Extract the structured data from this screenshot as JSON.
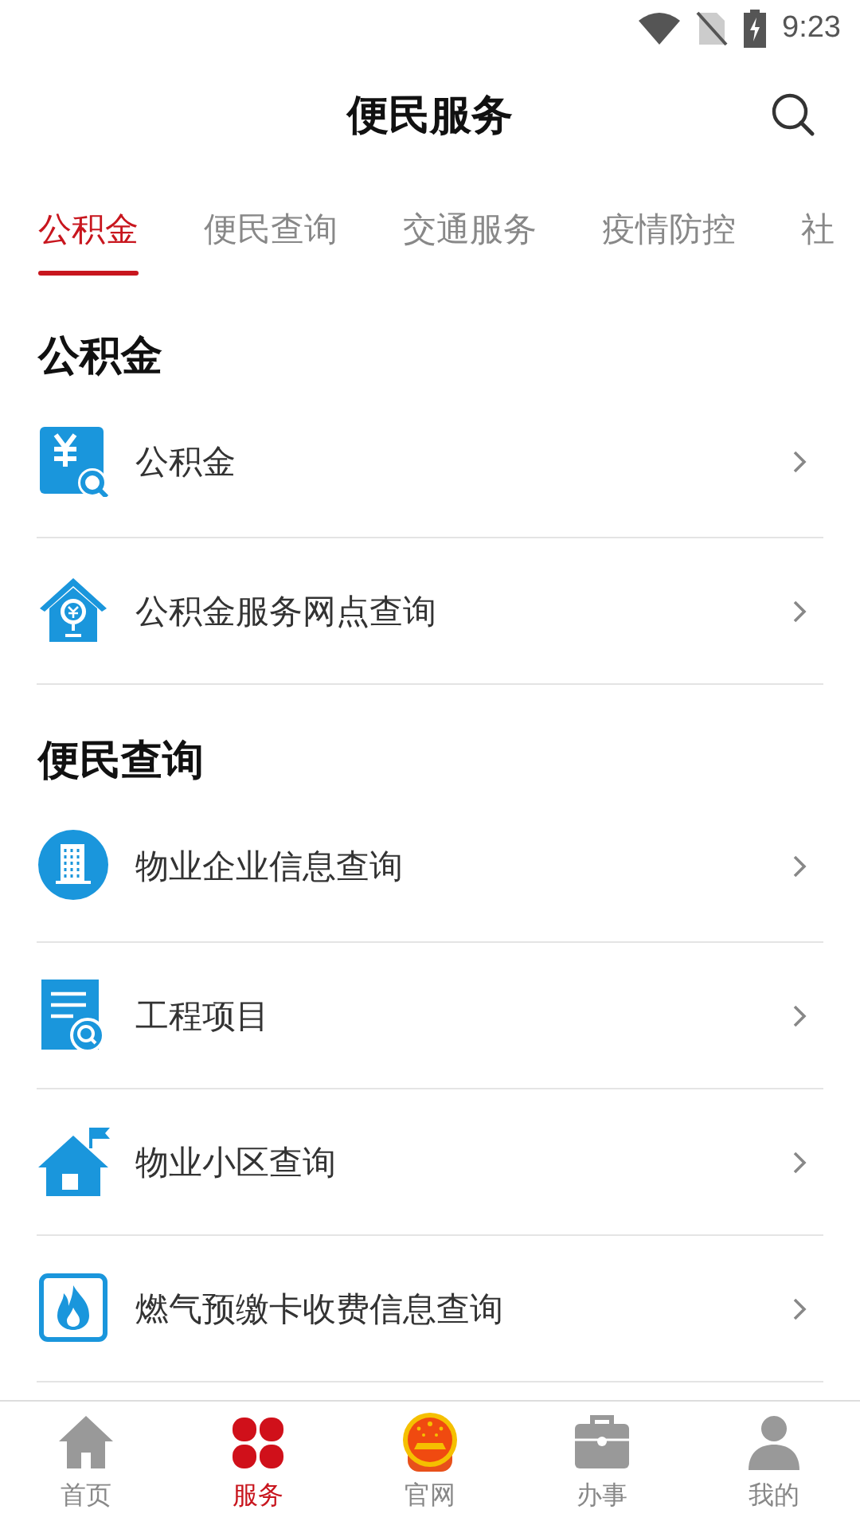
{
  "status_bar": {
    "time": "9:23"
  },
  "header": {
    "title": "便民服务"
  },
  "tabs": [
    {
      "label": "公积金",
      "selected": true
    },
    {
      "label": "便民查询",
      "selected": false
    },
    {
      "label": "交通服务",
      "selected": false
    },
    {
      "label": "疫情防控",
      "selected": false
    },
    {
      "label": "社",
      "selected": false
    }
  ],
  "sections": [
    {
      "title": "公积金",
      "items": [
        {
          "kind": "yuan-search",
          "label": "公积金"
        },
        {
          "kind": "house-yuan",
          "label": "公积金服务网点查询"
        }
      ]
    },
    {
      "title": "便民查询",
      "items": [
        {
          "kind": "building",
          "label": "物业企业信息查询"
        },
        {
          "kind": "document-search",
          "label": "工程项目"
        },
        {
          "kind": "house-flag",
          "label": "物业小区查询"
        },
        {
          "kind": "flame",
          "label": "燃气预缴卡收费信息查询"
        }
      ]
    }
  ],
  "bottom_nav": [
    {
      "kind": "home",
      "label": "首页",
      "selected": false
    },
    {
      "kind": "clover",
      "label": "服务",
      "selected": true
    },
    {
      "kind": "emblem",
      "label": "官网",
      "selected": false
    },
    {
      "kind": "briefcase",
      "label": "办事",
      "selected": false
    },
    {
      "kind": "person",
      "label": "我的",
      "selected": false
    }
  ]
}
